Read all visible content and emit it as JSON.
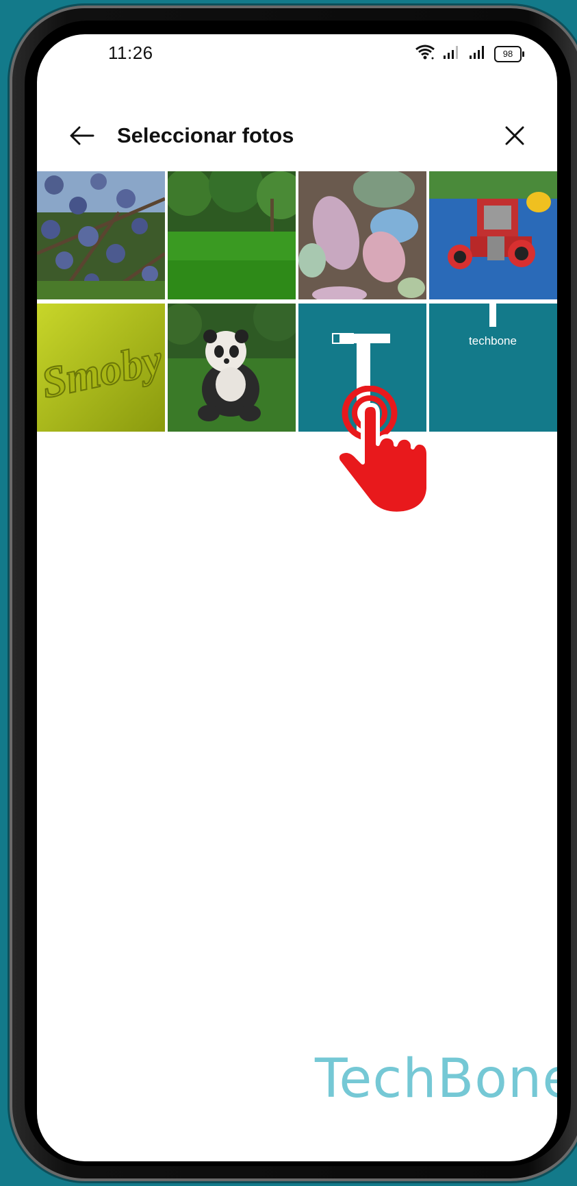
{
  "status_bar": {
    "time": "11:26",
    "battery": "98"
  },
  "header": {
    "title": "Seleccionar fotos"
  },
  "photos": [
    {
      "label": ""
    },
    {
      "label": ""
    },
    {
      "label": ""
    },
    {
      "label": ""
    },
    {
      "label": "Smoby"
    },
    {
      "label": ""
    },
    {
      "label": "T"
    },
    {
      "label": "techbone"
    }
  ],
  "watermark": "TechBone",
  "colors": {
    "frame_bg": "#137a8a",
    "tap_indicator": "#e8191c",
    "watermark": "#6ec6d3"
  }
}
